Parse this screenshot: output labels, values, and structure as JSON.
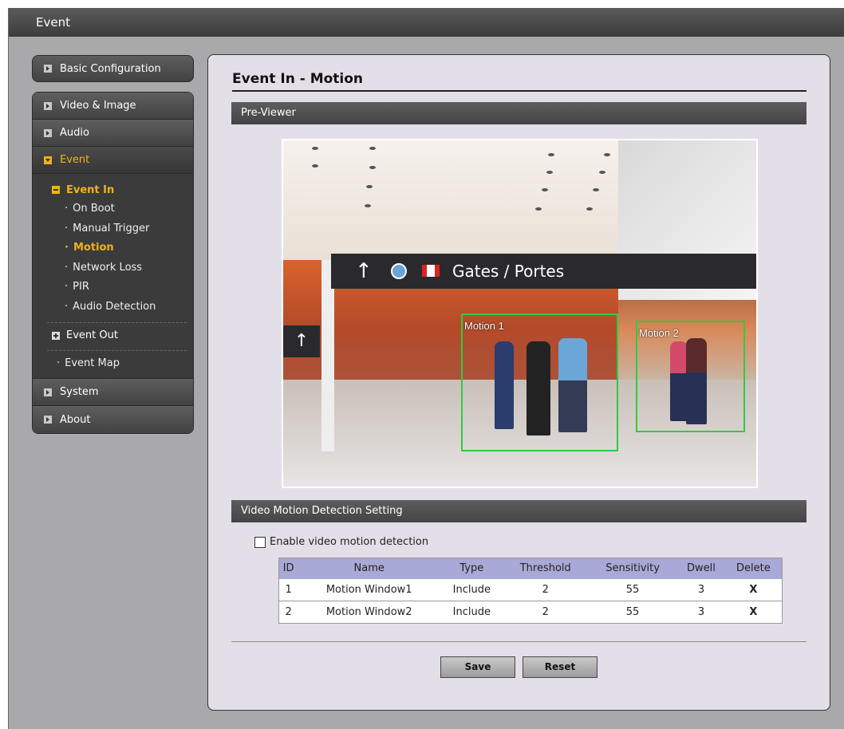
{
  "window": {
    "title": "Event"
  },
  "sidebar": {
    "basic": "Basic Configuration",
    "video": "Video & Image",
    "audio": "Audio",
    "event": "Event",
    "event_in": "Event In",
    "event_in_items": [
      "On Boot",
      "Manual Trigger",
      "Motion",
      "Network Loss",
      "PIR",
      "Audio Detection"
    ],
    "event_out": "Event Out",
    "event_map": "Event Map",
    "system": "System",
    "about": "About"
  },
  "main": {
    "title": "Event In - Motion",
    "previewer_label": "Pre-Viewer",
    "preview": {
      "sign_text": "Gates / Portes",
      "motion_1": "Motion 1",
      "motion_2": "Motion 2"
    },
    "vmd_label": "Video Motion Detection Setting",
    "enable_label": "Enable video motion detection",
    "enable_checked": false,
    "table": {
      "headers": [
        "ID",
        "Name",
        "Type",
        "Threshold",
        "Sensitivity",
        "Dwell",
        "Delete"
      ],
      "rows": [
        [
          "1",
          "Motion Window1",
          "Include",
          "2",
          "55",
          "3",
          "X"
        ],
        [
          "2",
          "Motion Window2",
          "Include",
          "2",
          "55",
          "3",
          "X"
        ]
      ]
    },
    "save": "Save",
    "reset": "Reset"
  },
  "colors": {
    "accent": "#f2b21a",
    "motion_box": "#2ecc40",
    "table_header": "#a9a9d7"
  }
}
